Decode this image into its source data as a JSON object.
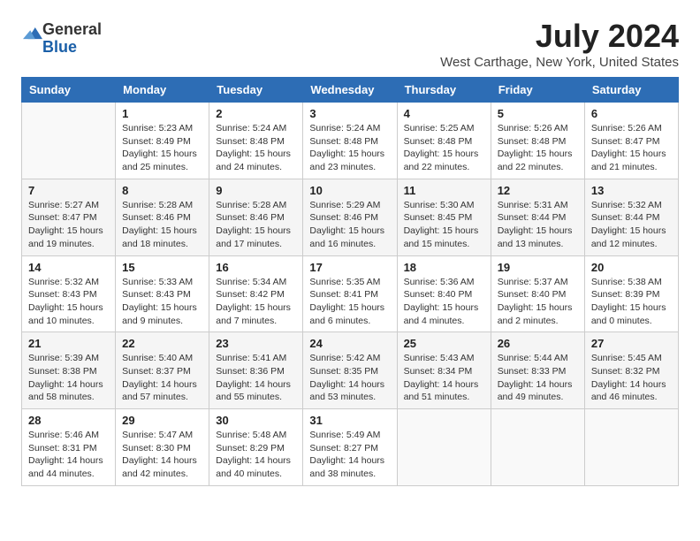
{
  "logo": {
    "general": "General",
    "blue": "Blue"
  },
  "title": "July 2024",
  "location": "West Carthage, New York, United States",
  "headers": [
    "Sunday",
    "Monday",
    "Tuesday",
    "Wednesday",
    "Thursday",
    "Friday",
    "Saturday"
  ],
  "weeks": [
    [
      {
        "day": "",
        "info": ""
      },
      {
        "day": "1",
        "info": "Sunrise: 5:23 AM\nSunset: 8:49 PM\nDaylight: 15 hours\nand 25 minutes."
      },
      {
        "day": "2",
        "info": "Sunrise: 5:24 AM\nSunset: 8:48 PM\nDaylight: 15 hours\nand 24 minutes."
      },
      {
        "day": "3",
        "info": "Sunrise: 5:24 AM\nSunset: 8:48 PM\nDaylight: 15 hours\nand 23 minutes."
      },
      {
        "day": "4",
        "info": "Sunrise: 5:25 AM\nSunset: 8:48 PM\nDaylight: 15 hours\nand 22 minutes."
      },
      {
        "day": "5",
        "info": "Sunrise: 5:26 AM\nSunset: 8:48 PM\nDaylight: 15 hours\nand 22 minutes."
      },
      {
        "day": "6",
        "info": "Sunrise: 5:26 AM\nSunset: 8:47 PM\nDaylight: 15 hours\nand 21 minutes."
      }
    ],
    [
      {
        "day": "7",
        "info": "Sunrise: 5:27 AM\nSunset: 8:47 PM\nDaylight: 15 hours\nand 19 minutes."
      },
      {
        "day": "8",
        "info": "Sunrise: 5:28 AM\nSunset: 8:46 PM\nDaylight: 15 hours\nand 18 minutes."
      },
      {
        "day": "9",
        "info": "Sunrise: 5:28 AM\nSunset: 8:46 PM\nDaylight: 15 hours\nand 17 minutes."
      },
      {
        "day": "10",
        "info": "Sunrise: 5:29 AM\nSunset: 8:46 PM\nDaylight: 15 hours\nand 16 minutes."
      },
      {
        "day": "11",
        "info": "Sunrise: 5:30 AM\nSunset: 8:45 PM\nDaylight: 15 hours\nand 15 minutes."
      },
      {
        "day": "12",
        "info": "Sunrise: 5:31 AM\nSunset: 8:44 PM\nDaylight: 15 hours\nand 13 minutes."
      },
      {
        "day": "13",
        "info": "Sunrise: 5:32 AM\nSunset: 8:44 PM\nDaylight: 15 hours\nand 12 minutes."
      }
    ],
    [
      {
        "day": "14",
        "info": "Sunrise: 5:32 AM\nSunset: 8:43 PM\nDaylight: 15 hours\nand 10 minutes."
      },
      {
        "day": "15",
        "info": "Sunrise: 5:33 AM\nSunset: 8:43 PM\nDaylight: 15 hours\nand 9 minutes."
      },
      {
        "day": "16",
        "info": "Sunrise: 5:34 AM\nSunset: 8:42 PM\nDaylight: 15 hours\nand 7 minutes."
      },
      {
        "day": "17",
        "info": "Sunrise: 5:35 AM\nSunset: 8:41 PM\nDaylight: 15 hours\nand 6 minutes."
      },
      {
        "day": "18",
        "info": "Sunrise: 5:36 AM\nSunset: 8:40 PM\nDaylight: 15 hours\nand 4 minutes."
      },
      {
        "day": "19",
        "info": "Sunrise: 5:37 AM\nSunset: 8:40 PM\nDaylight: 15 hours\nand 2 minutes."
      },
      {
        "day": "20",
        "info": "Sunrise: 5:38 AM\nSunset: 8:39 PM\nDaylight: 15 hours\nand 0 minutes."
      }
    ],
    [
      {
        "day": "21",
        "info": "Sunrise: 5:39 AM\nSunset: 8:38 PM\nDaylight: 14 hours\nand 58 minutes."
      },
      {
        "day": "22",
        "info": "Sunrise: 5:40 AM\nSunset: 8:37 PM\nDaylight: 14 hours\nand 57 minutes."
      },
      {
        "day": "23",
        "info": "Sunrise: 5:41 AM\nSunset: 8:36 PM\nDaylight: 14 hours\nand 55 minutes."
      },
      {
        "day": "24",
        "info": "Sunrise: 5:42 AM\nSunset: 8:35 PM\nDaylight: 14 hours\nand 53 minutes."
      },
      {
        "day": "25",
        "info": "Sunrise: 5:43 AM\nSunset: 8:34 PM\nDaylight: 14 hours\nand 51 minutes."
      },
      {
        "day": "26",
        "info": "Sunrise: 5:44 AM\nSunset: 8:33 PM\nDaylight: 14 hours\nand 49 minutes."
      },
      {
        "day": "27",
        "info": "Sunrise: 5:45 AM\nSunset: 8:32 PM\nDaylight: 14 hours\nand 46 minutes."
      }
    ],
    [
      {
        "day": "28",
        "info": "Sunrise: 5:46 AM\nSunset: 8:31 PM\nDaylight: 14 hours\nand 44 minutes."
      },
      {
        "day": "29",
        "info": "Sunrise: 5:47 AM\nSunset: 8:30 PM\nDaylight: 14 hours\nand 42 minutes."
      },
      {
        "day": "30",
        "info": "Sunrise: 5:48 AM\nSunset: 8:29 PM\nDaylight: 14 hours\nand 40 minutes."
      },
      {
        "day": "31",
        "info": "Sunrise: 5:49 AM\nSunset: 8:27 PM\nDaylight: 14 hours\nand 38 minutes."
      },
      {
        "day": "",
        "info": ""
      },
      {
        "day": "",
        "info": ""
      },
      {
        "day": "",
        "info": ""
      }
    ]
  ]
}
